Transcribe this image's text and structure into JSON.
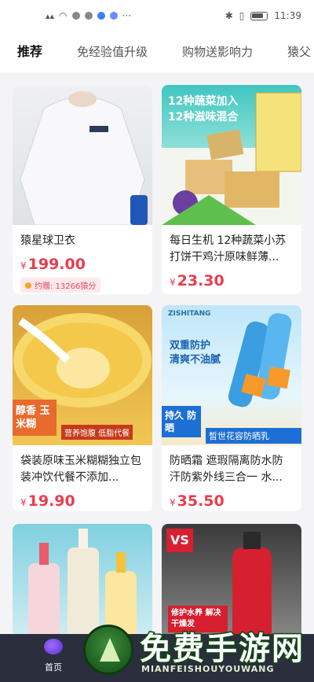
{
  "status_bar": {
    "time": "11:39"
  },
  "tabs": [
    {
      "label": "推荐",
      "active": true
    },
    {
      "label": "免经验值升级",
      "active": false
    },
    {
      "label": "购物送影响力",
      "active": false
    },
    {
      "label": "猿父",
      "active": false
    }
  ],
  "products": [
    {
      "title": "猿星球卫衣",
      "price_symbol": "¥",
      "price": "199.00",
      "promo": "约赠: 13266猿分",
      "image_icon": "white-sweatshirt-image"
    },
    {
      "title": "每日生机 12种蔬菜小苏打饼干鸡汁原味鲜薄...",
      "price_symbol": "¥",
      "price": "23.30",
      "image_icon": "vegetable-crackers-image",
      "image_text": {
        "line1": "12种蔬菜加入",
        "line2": "12种滋味混合"
      }
    },
    {
      "title": "袋装原味玉米糊糊独立包装冲饮代餐不添加...",
      "price_symbol": "¥",
      "price": "19.90",
      "image_icon": "corn-porridge-image",
      "image_text": {
        "tag": "醇香 玉米糊",
        "badge": "营养饱腹 低脂代餐"
      }
    },
    {
      "title": "防晒霜 遮瑕隔离防水防汗防紫外线三合一 水...",
      "price_symbol": "¥",
      "price": "35.50",
      "image_icon": "sunscreen-image",
      "image_text": {
        "brand": "ZISHITANG",
        "line1": "双重防护",
        "line2": "清爽不油腻",
        "tag": "持久 防晒",
        "name": "皙世花容防晒乳"
      }
    },
    {
      "title": "",
      "image_icon": "body-wash-bottles-image"
    },
    {
      "title": "",
      "image_icon": "vs-hair-care-image",
      "image_text": {
        "logo": "VS",
        "banner": "修护水养 解决干燥发"
      }
    }
  ],
  "bottom_nav": {
    "home_label": "首页"
  },
  "watermark": {
    "title": "免费手游网",
    "subtitle": "MIANFEISHOUYOUWANG"
  },
  "colors": {
    "accent": "#e83d4f",
    "tab_underline": "#ff6b7a",
    "nav_bg": "#2a2e3d"
  }
}
